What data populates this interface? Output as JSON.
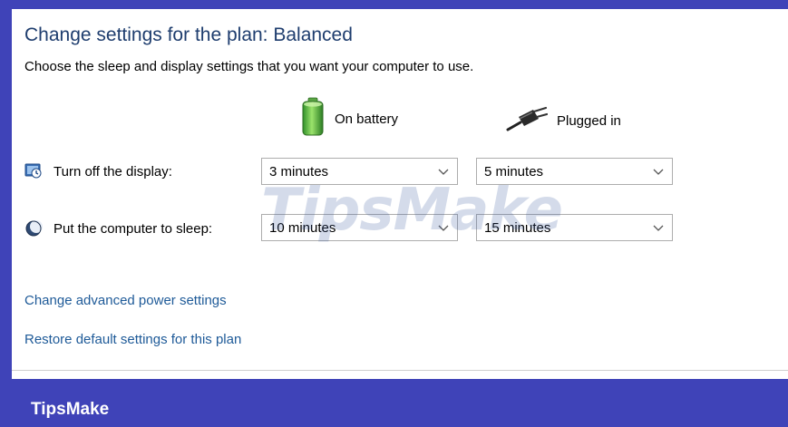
{
  "header": {
    "title": "Change settings for the plan: Balanced",
    "subtitle": "Choose the sleep and display settings that you want your computer to use."
  },
  "columns": {
    "battery_label": "On battery",
    "battery_icon": "battery-icon",
    "plugged_label": "Plugged in",
    "plugged_icon": "power-plug-icon"
  },
  "settings": [
    {
      "label": "Turn off the display:",
      "icon": "display-icon",
      "on_battery": "3 minutes",
      "plugged_in": "5 minutes"
    },
    {
      "label": "Put the computer to sleep:",
      "icon": "sleep-moon-icon",
      "on_battery": "10 minutes",
      "plugged_in": "15 minutes"
    }
  ],
  "links": {
    "advanced": "Change advanced power settings",
    "restore": "Restore default settings for this plan"
  },
  "watermark": "TipsMake",
  "footer": {
    "brand": "TipsMake"
  },
  "colors": {
    "frame": "#3f43b8",
    "title_text": "#1e3d6e",
    "link_text": "#1e5a98"
  }
}
